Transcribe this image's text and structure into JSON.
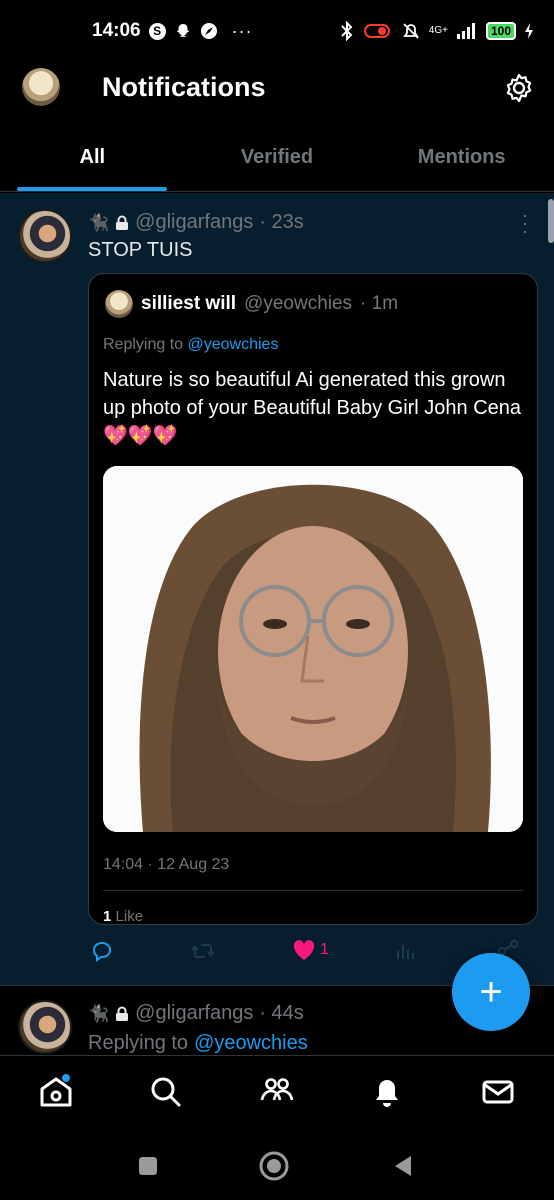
{
  "status_bar": {
    "time": "14:06",
    "network": "4G+",
    "battery": "100",
    "overflow_dots": "···"
  },
  "header": {
    "title": "Notifications"
  },
  "tabs": [
    {
      "label": "All",
      "active": true
    },
    {
      "label": "Verified",
      "active": false
    },
    {
      "label": "Mentions",
      "active": false
    }
  ],
  "post1": {
    "handle": "@gligarfangs",
    "age": "· 23s",
    "text": "STOP TUIS",
    "quote": {
      "name": "silliest will",
      "handle": "@yeowchies",
      "age": "· 1m",
      "replying_prefix": "Replying to",
      "replying_to": "@yeowchies",
      "body": "Nature is so beautiful Ai generated this grown up photo of your Beautiful Baby Girl John Cena💖💖💖",
      "timestamp": "14:04 · 12 Aug 23",
      "likes_count": "1",
      "likes_label": "Like"
    },
    "actions": {
      "like_count": "1"
    }
  },
  "post2": {
    "handle": "@gligarfangs",
    "age": "· 44s",
    "replying_prefix": "Replying to",
    "replying_to": "@yeowchies"
  },
  "fab": {
    "label": "+"
  },
  "colors": {
    "accent": "#1d9bf0",
    "like": "#f91880",
    "highlight_bg": "#061e2e"
  }
}
